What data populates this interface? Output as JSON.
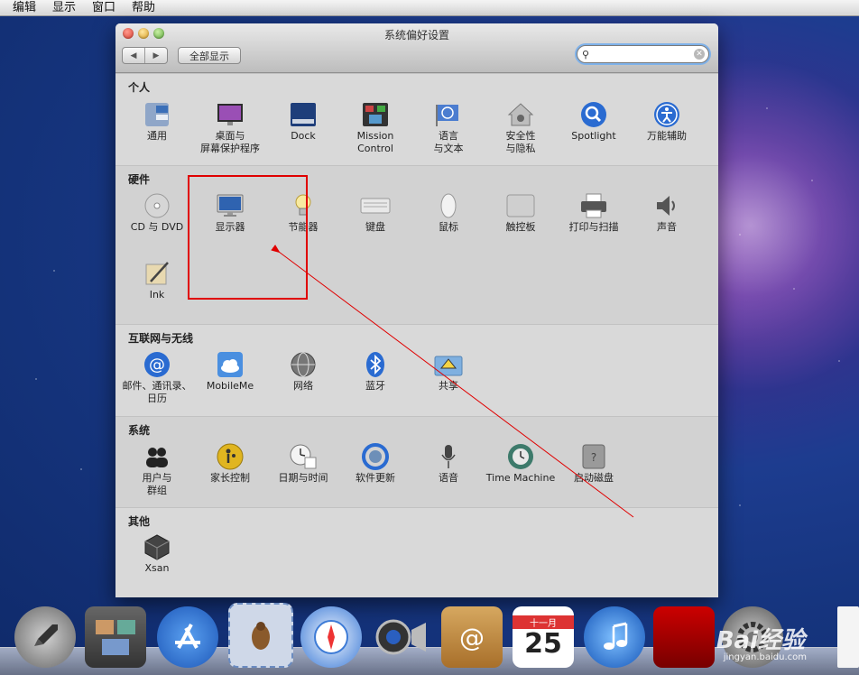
{
  "menubar": {
    "items": [
      "编辑",
      "显示",
      "窗口",
      "帮助"
    ]
  },
  "window": {
    "title": "系统偏好设置",
    "show_all": "全部显示",
    "search_value": ""
  },
  "sections": {
    "personal": {
      "title": "个人",
      "items": [
        "通用",
        "桌面与\n屏幕保护程序",
        "Dock",
        "Mission\nControl",
        "语言\n与文本",
        "安全性\n与隐私",
        "Spotlight",
        "万能辅助"
      ]
    },
    "hardware": {
      "title": "硬件",
      "items": [
        "CD 与 DVD",
        "显示器",
        "节能器",
        "键盘",
        "鼠标",
        "触控板",
        "打印与扫描",
        "声音",
        "Ink"
      ]
    },
    "internet": {
      "title": "互联网与无线",
      "items": [
        "邮件、通讯录、\n日历",
        "MobileMe",
        "网络",
        "蓝牙",
        "共享"
      ]
    },
    "system": {
      "title": "系统",
      "items": [
        "用户与\n群组",
        "家长控制",
        "日期与时间",
        "软件更新",
        "语音",
        "Time Machine",
        "启动磁盘"
      ]
    },
    "other": {
      "title": "其他",
      "items": [
        "Xsan"
      ]
    }
  },
  "dock": {
    "calendar_month": "十一月",
    "calendar_day": "25"
  },
  "watermark": {
    "text": "Bai经验",
    "url": "jingyan.baidu.com"
  },
  "annotation_color": "#e00000"
}
